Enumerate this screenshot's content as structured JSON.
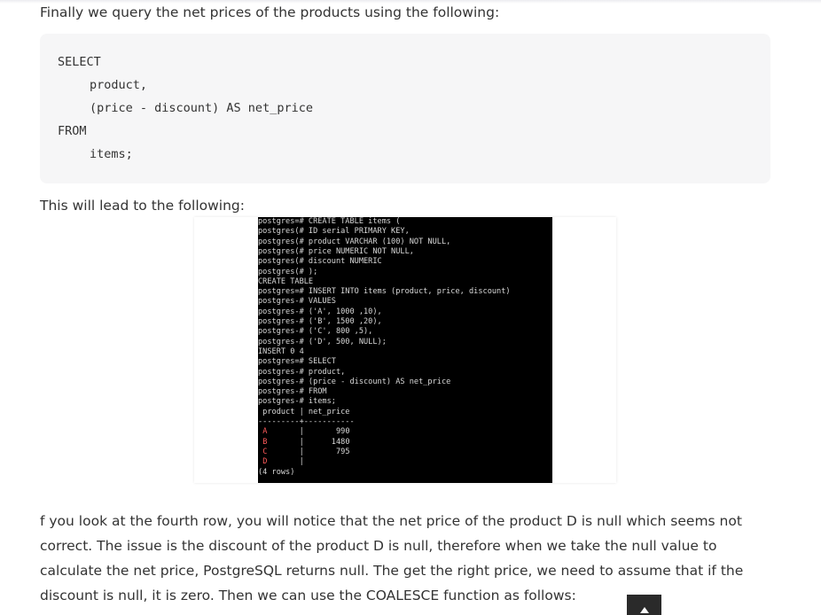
{
  "article": {
    "intro_text": "Finally we query the net prices of the products using the following:",
    "code_lines": [
      "SELECT",
      "product,",
      "(price - discount) AS net_price",
      "FROM",
      "items;"
    ],
    "lead_text": "This will lead to the following:",
    "explanation_text": "f you look at the fourth row, you will notice that the net price of the product D is null which seems not correct. The issue is the discount of the product D is null, therefore when we take the null value to calculate the net price, PostgreSQL returns null. The get the right price, we need to assume that if the discount is null, it is zero. Then we can use the COALESCE function as follows:"
  },
  "terminal": {
    "lines": [
      "postgres=# CREATE TABLE items (",
      "postgres(# ID serial PRIMARY KEY,",
      "postgres(# product VARCHAR (100) NOT NULL,",
      "postgres(# price NUMERIC NOT NULL,",
      "postgres(# discount NUMERIC",
      "postgres(# );",
      "CREATE TABLE",
      "postgres=# INSERT INTO items (product, price, discount)",
      "postgres-# VALUES",
      "postgres-# ('A', 1000 ,10),",
      "postgres-# ('B', 1500 ,20),",
      "postgres-# ('C', 800 ,5),",
      "postgres-# ('D', 500, NULL);",
      "INSERT 0 4",
      "postgres=# SELECT",
      "postgres-# product,",
      "postgres-# (price - discount) AS net_price",
      "postgres-# FROM",
      "postgres-# items;",
      " product | net_price",
      "---------+-----------",
      " A       |       990",
      " B       |      1480",
      " C       |       795",
      " D       |",
      "(4 rows)"
    ]
  },
  "scroll_top": {
    "icon": "arrow-up-icon"
  }
}
